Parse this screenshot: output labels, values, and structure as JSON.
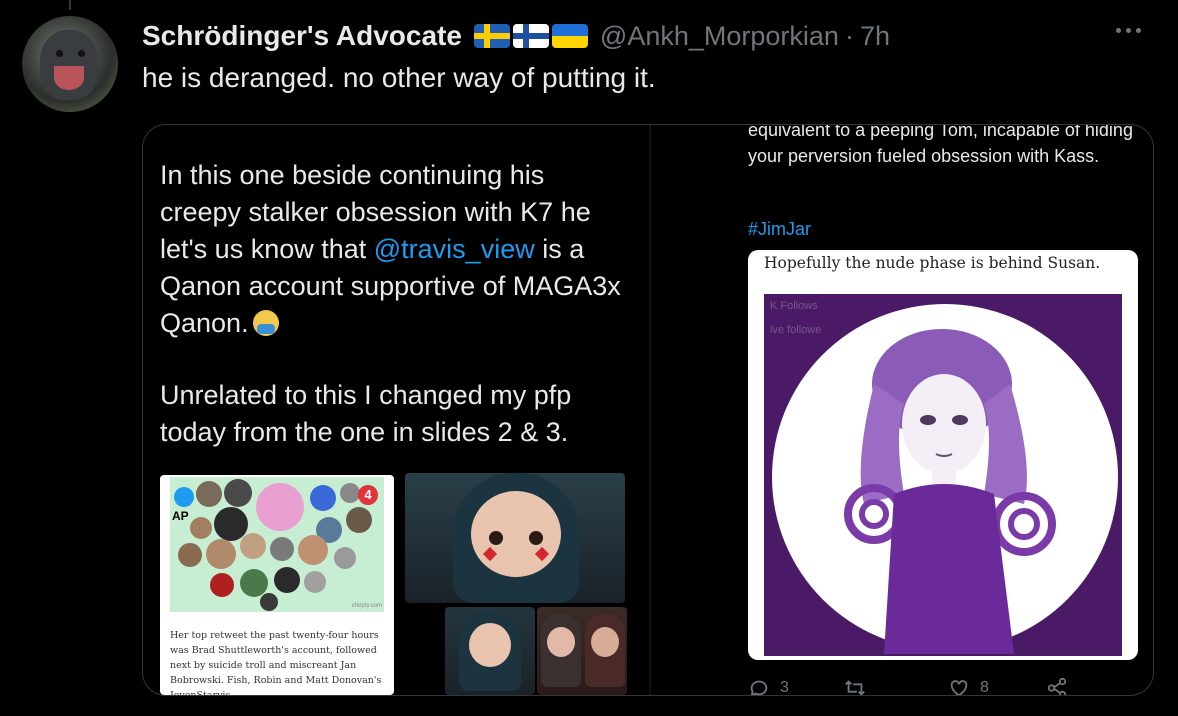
{
  "author": {
    "display_name": "Schrödinger's Advocate",
    "flags": [
      "sweden-flag",
      "finland-flag",
      "ukraine-flag"
    ],
    "handle": "@Ankh_Morporkian",
    "separator": "·",
    "time": "7h"
  },
  "tweet": {
    "text": "he is deranged. no other way of putting it."
  },
  "media": {
    "slide1": {
      "text_before_mention": "In this one beside continuing his creepy stalker obsession with K7 he let's us know that ",
      "mention": "@travis_view",
      "text_after_mention": " is a Qanon account supportive of MAGA3x Qanon.",
      "emoji": "facepalm-emoji",
      "paragraph2": "Unrelated to this I changed my pfp today from the one in slides 2 & 3.",
      "collage": {
        "ap_label": "AP",
        "badge_number": "4",
        "credit": "chirpty.com",
        "caption": "Her top retweet the past twenty-four hours was Brad Shuttleworth's account, followed next by suicide troll and miscreant Jan Bobrowski. Fish, Robin and Matt Donovan's JevenStarvis"
      }
    },
    "slide2": {
      "text": "equivalent to a peeping Tom, incapable of hiding your perversion fueled obsession with Kass.",
      "hashtag": "#JimJar",
      "image_caption": "Hopefully the nude phase is behind Susan.",
      "faint_overlay": [
        "K Follows",
        "ive followe"
      ]
    },
    "actions": {
      "reply_count": "3",
      "retweet_count": "",
      "like_count": "8"
    }
  },
  "colors": {
    "background": "#000000",
    "text_primary": "#e7e9ea",
    "text_secondary": "#71767b",
    "link": "#1d9bf0",
    "border": "#333639",
    "art_purple": "#4a1a66"
  }
}
